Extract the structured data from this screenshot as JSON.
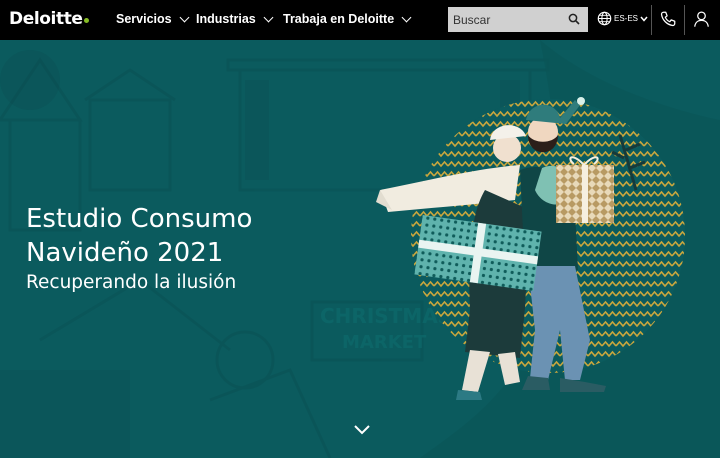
{
  "header": {
    "logo_text": "Deloitte",
    "nav": [
      {
        "label": "Servicios"
      },
      {
        "label": "Industrias"
      },
      {
        "label": "Trabaja en Deloitte"
      }
    ],
    "search_placeholder": "Buscar",
    "language": "ES-ES",
    "icons": [
      "search-icon",
      "globe-icon",
      "chevron-down-icon",
      "phone-icon",
      "user-icon"
    ]
  },
  "hero": {
    "title_line1": "Estudio Consumo",
    "title_line2": "Navideño 2021",
    "subtitle": "Recuperando la ilusión",
    "scroll_icon": "chevron-down-icon"
  },
  "colors": {
    "nav_bg": "#000000",
    "hero_bg": "#0b5b5e",
    "brand_dot": "#86bc25",
    "zigzag": "#c9a63d"
  }
}
